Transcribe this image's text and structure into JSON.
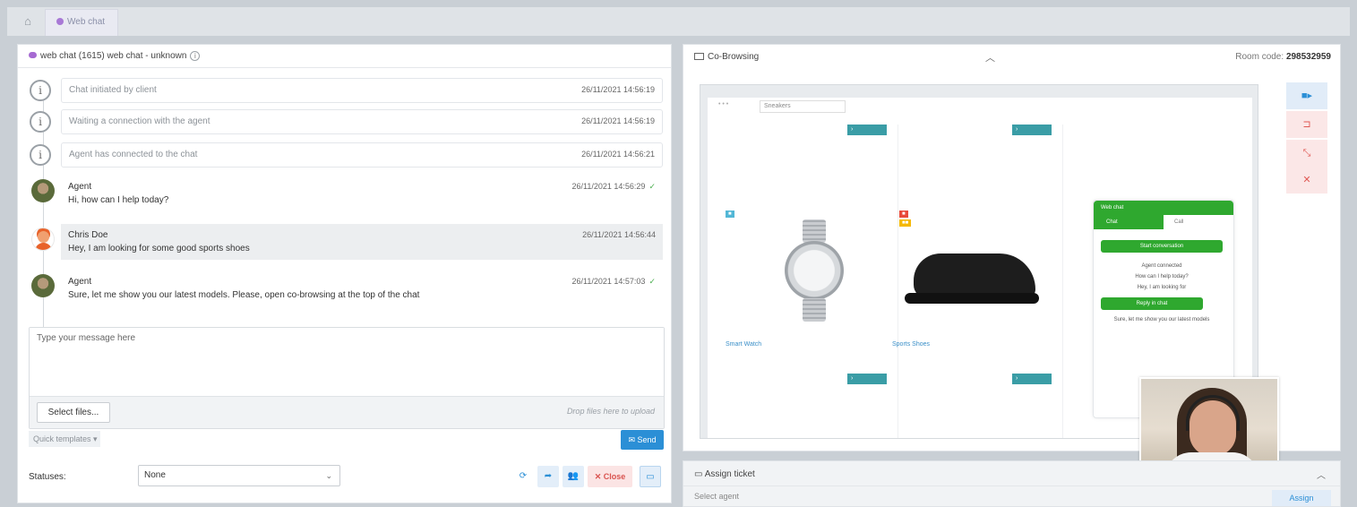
{
  "topbar": {
    "home_icon": "home-icon",
    "tab_label": "Web chat"
  },
  "chat": {
    "header_title": "web chat (1615) web chat - unknown",
    "system_messages": [
      {
        "text": "Chat initiated by client",
        "time": "26/11/2021 14:56:19"
      },
      {
        "text": "Waiting a connection with the agent",
        "time": "26/11/2021 14:56:19"
      },
      {
        "text": "Agent has connected to the chat",
        "time": "26/11/2021 14:56:21"
      }
    ],
    "messages": [
      {
        "name": "Agent",
        "text": "Hi, how can I help today?",
        "time": "26/11/2021 14:56:29"
      },
      {
        "name": "Chris Doe",
        "text": "Hey, I am looking for some good sports shoes",
        "time": "26/11/2021 14:56:44"
      },
      {
        "name": "Agent",
        "text": "Sure, let me show you our latest models. Please, open co-browsing at the top of the chat",
        "time": "26/11/2021 14:57:03"
      }
    ],
    "composer_placeholder": "Type your message here",
    "select_files_label": "Select files...",
    "drop_hint": "Drop files here to upload",
    "quick_reply_label": "Quick templates",
    "send_label": "Send",
    "status_label": "Statuses:",
    "status_value": "None",
    "close_label": "Close"
  },
  "cobrowse": {
    "title": "Co-Browsing",
    "room_label": "Room code:",
    "room_code": "298532959",
    "site_select": "Sneakers",
    "watch_caption": "Smart Watch",
    "shoe_caption": "Sports Shoes",
    "widget": {
      "title": "Web chat",
      "tab_chat": "Chat",
      "tab_other": "Call",
      "start_btn": "Start conversation",
      "line1": "Agent connected",
      "line2": "How can I help today?",
      "line3": "Hey, I am looking for",
      "reply_btn": "Reply in chat",
      "line4": "Sure, let me show you our latest models"
    }
  },
  "assign": {
    "title": "Assign ticket",
    "row_text": "Select agent",
    "button_label": "Assign"
  },
  "colors": {
    "accent_blue": "#2b8fd6",
    "danger_red": "#d9534f",
    "widget_green": "#2fa82f",
    "teal": "#3a9da6"
  }
}
